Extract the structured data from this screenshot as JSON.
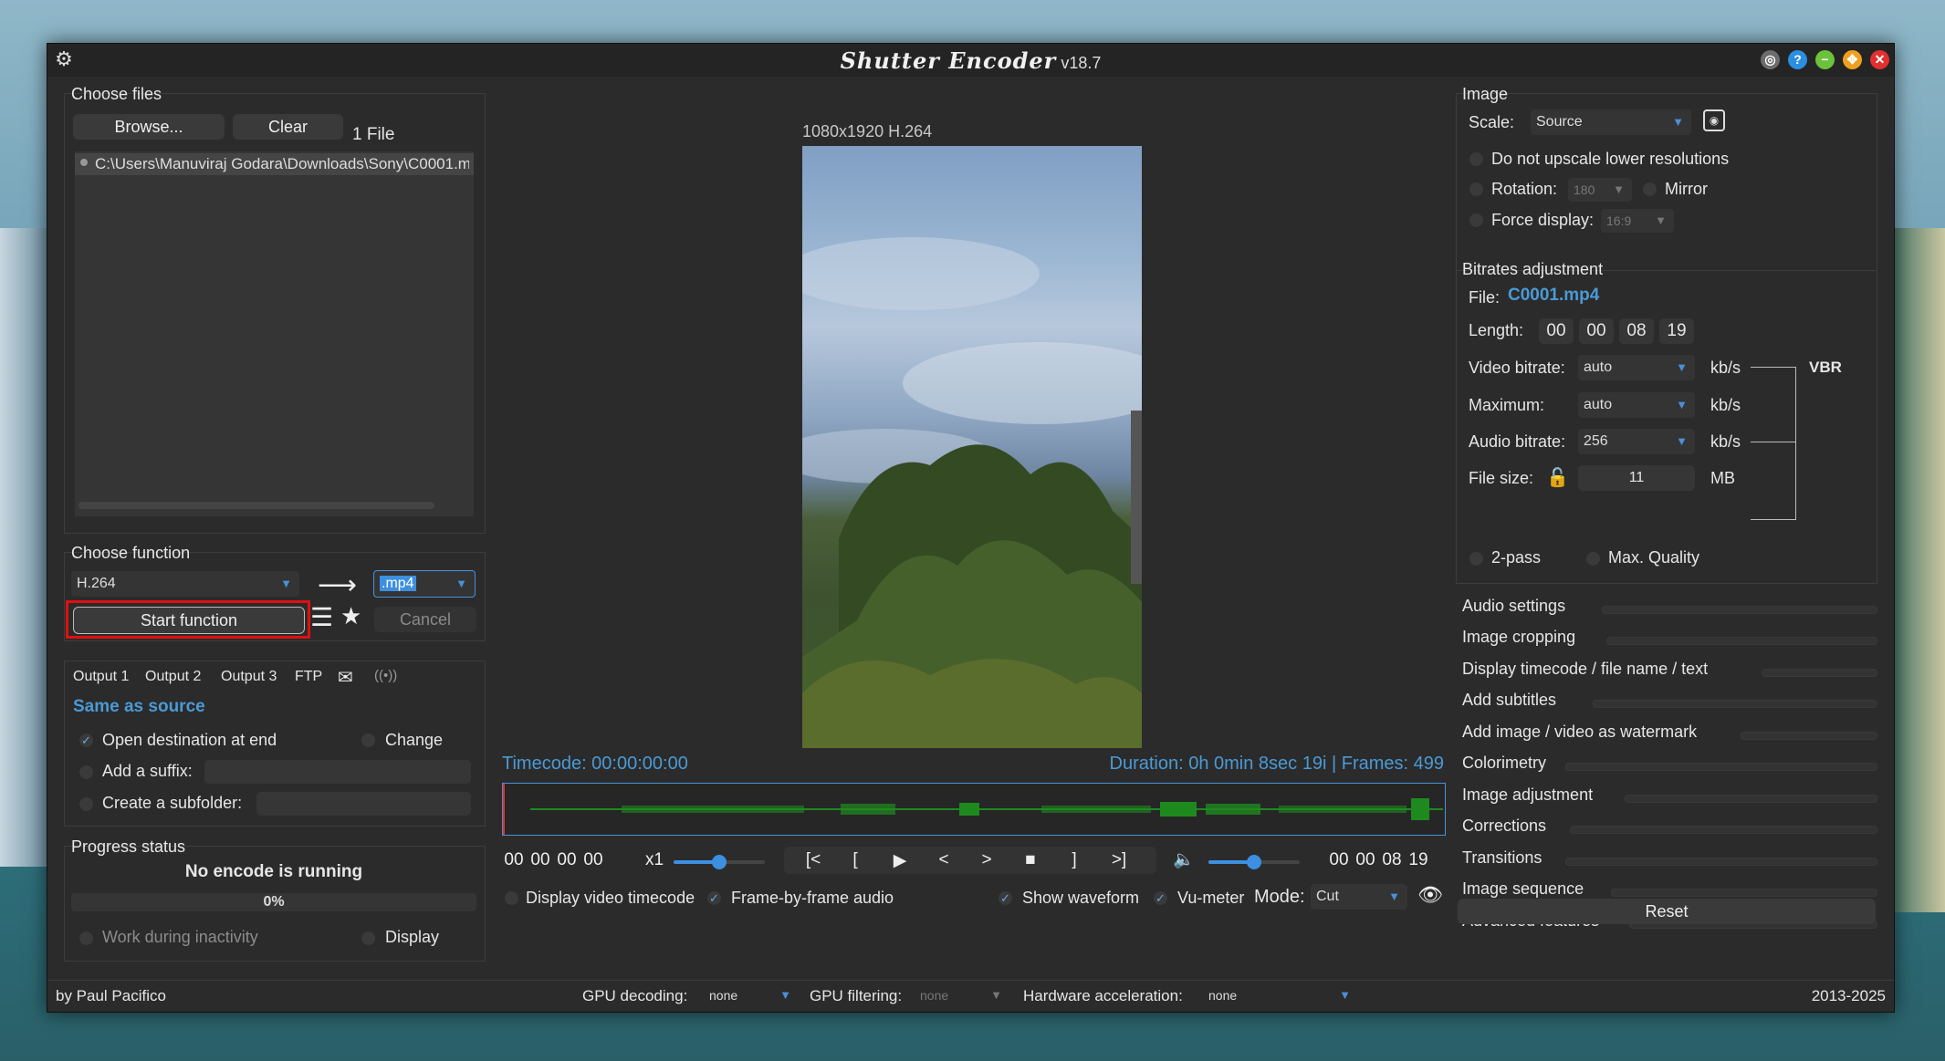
{
  "window": {
    "title_logo": "Shutter Encoder",
    "version": "v18.7"
  },
  "choose_files": {
    "title": "Choose files",
    "browse": "Browse...",
    "clear": "Clear",
    "count": "1 File",
    "files": [
      "C:\\Users\\Manuviraj Godara\\Downloads\\Sony\\C0001.mp4"
    ]
  },
  "choose_function": {
    "title": "Choose function",
    "function": "H.264",
    "extension": ".mp4",
    "start": "Start function",
    "cancel": "Cancel"
  },
  "output": {
    "tabs": [
      "Output 1",
      "Output 2",
      "Output 3",
      "FTP"
    ],
    "destination": "Same as source",
    "open_destination": "Open destination at end",
    "change": "Change",
    "add_suffix": "Add a suffix:",
    "create_subfolder": "Create a subfolder:"
  },
  "progress": {
    "title": "Progress status",
    "status": "No encode is running",
    "percent": "0%",
    "work_inactivity": "Work during inactivity",
    "display": "Display"
  },
  "preview": {
    "info": "1080x1920 H.264",
    "timecode": "Timecode: 00:00:00:00",
    "duration": "Duration: 0h 0min 8sec 19i | Frames: 499",
    "tc_in": [
      "00",
      "00",
      "00",
      "00"
    ],
    "tc_out": [
      "00",
      "00",
      "08",
      "19"
    ],
    "speed": "x1",
    "speed_level": 0.5,
    "volume_level": 0.5,
    "controls": [
      "[<",
      "[",
      "▶",
      "<",
      ">",
      "■",
      "]",
      ">]"
    ],
    "display_video_timecode": "Display video timecode",
    "frame_by_frame_audio": "Frame-by-frame audio",
    "show_waveform": "Show waveform",
    "vu_meter": "Vu-meter",
    "mode_label": "Mode:",
    "mode": "Cut"
  },
  "image": {
    "title": "Image",
    "scale_label": "Scale:",
    "scale": "Source",
    "no_upscale": "Do not upscale lower resolutions",
    "rotation_label": "Rotation:",
    "rotation": "180",
    "mirror": "Mirror",
    "force_display_label": "Force display:",
    "force_display": "16:9"
  },
  "bitrates": {
    "title": "Bitrates adjustment",
    "file_label": "File:",
    "file": "C0001.mp4",
    "length_label": "Length:",
    "length": [
      "00",
      "00",
      "08",
      "19"
    ],
    "video_label": "Video bitrate:",
    "video": "auto",
    "max_label": "Maximum:",
    "max": "auto",
    "audio_label": "Audio bitrate:",
    "audio": "256",
    "size_label": "File size:",
    "size": "11",
    "unit_kbs": "kb/s",
    "unit_mb": "MB",
    "vbr": "VBR",
    "two_pass": "2-pass",
    "max_quality": "Max. Quality"
  },
  "sections": [
    "Audio settings",
    "Image cropping",
    "Display timecode / file name / text",
    "Add subtitles",
    "Add image / video as watermark",
    "Colorimetry",
    "Image adjustment",
    "Corrections",
    "Transitions",
    "Image sequence",
    "Advanced features"
  ],
  "reset": "Reset",
  "footer": {
    "author": "by Paul Pacifico",
    "gpu_decoding_label": "GPU decoding:",
    "gpu_decoding": "none",
    "gpu_filtering_label": "GPU filtering:",
    "gpu_filtering": "none",
    "hw_accel_label": "Hardware acceleration:",
    "hw_accel": "none",
    "years": "2013-2025"
  }
}
